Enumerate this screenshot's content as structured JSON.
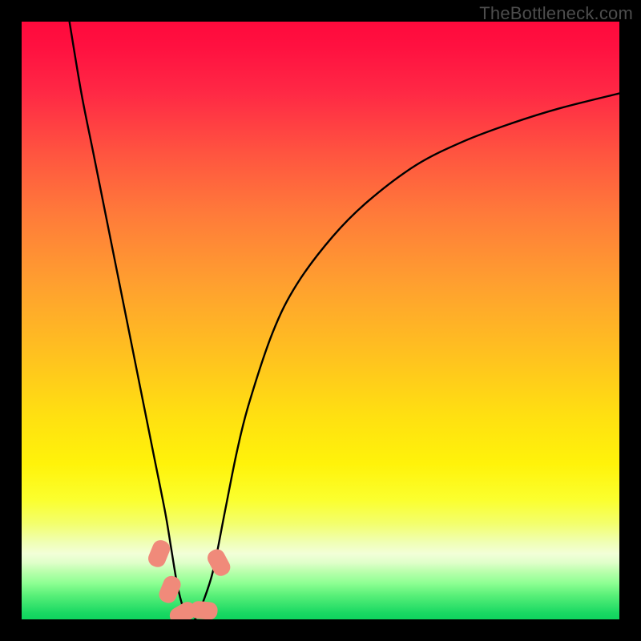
{
  "attribution": "TheBottleneck.com",
  "chart_data": {
    "type": "line",
    "title": "",
    "xlabel": "",
    "ylabel": "",
    "xlim": [
      0,
      100
    ],
    "ylim": [
      0,
      100
    ],
    "background_gradient": {
      "top": "#ff0a3c",
      "mid": "#fff30a",
      "bottom": "#0fd45e"
    },
    "series": [
      {
        "name": "bottleneck-curve",
        "color": "#000000",
        "x": [
          8,
          10,
          12,
          14,
          16,
          18,
          20,
          22,
          24,
          25,
          26,
          27,
          28,
          29,
          30,
          32,
          34,
          36,
          38,
          42,
          46,
          52,
          58,
          66,
          74,
          82,
          90,
          100
        ],
        "y": [
          100,
          88,
          78,
          68,
          58,
          48,
          38,
          28,
          18,
          12,
          6,
          2,
          0,
          0,
          2,
          8,
          18,
          28,
          36,
          48,
          56,
          64,
          70,
          76,
          80,
          83,
          85.5,
          88
        ]
      }
    ],
    "markers": [
      {
        "name": "marker-left-upper",
        "x": 23.0,
        "y": 11.0,
        "color": "#f08a7a"
      },
      {
        "name": "marker-left-mid",
        "x": 24.8,
        "y": 5.0,
        "color": "#f08a7a"
      },
      {
        "name": "marker-bottom-left",
        "x": 27.0,
        "y": 1.0,
        "color": "#f08a7a"
      },
      {
        "name": "marker-bottom-right",
        "x": 30.5,
        "y": 1.5,
        "color": "#f08a7a"
      },
      {
        "name": "marker-right",
        "x": 33.0,
        "y": 9.5,
        "color": "#f08a7a"
      }
    ]
  }
}
